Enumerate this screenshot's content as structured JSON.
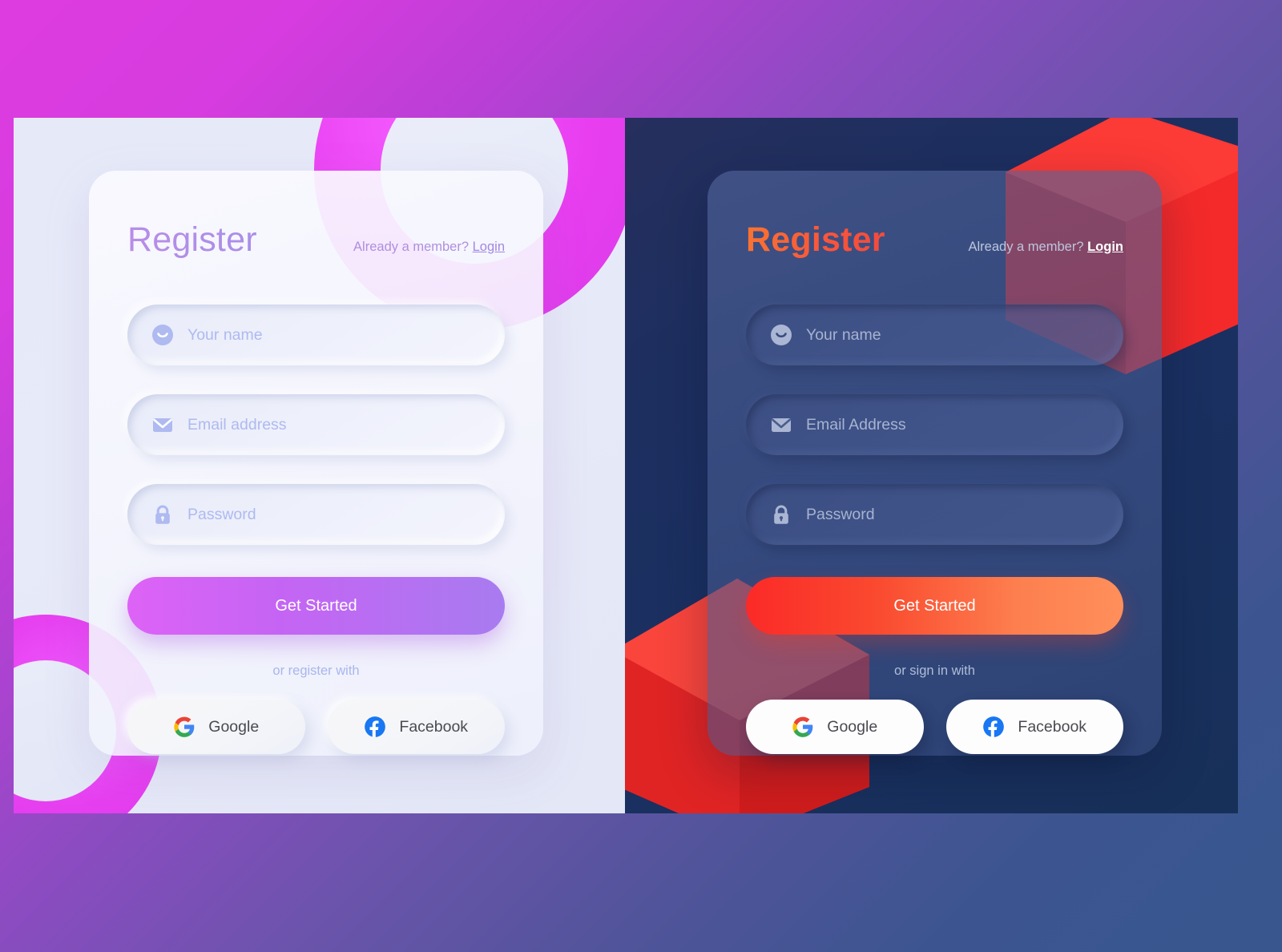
{
  "background": {
    "gradient_from": "#dd3ce0",
    "gradient_mid": "#6a54ab",
    "gradient_to": "#39568f"
  },
  "light_card": {
    "title": "Register",
    "member_prefix": "Already a member?",
    "login_label": "Login",
    "title_color": "#b08ee8",
    "fields": [
      {
        "icon": "smiley-icon",
        "placeholder": "Your name"
      },
      {
        "icon": "envelope-icon",
        "placeholder": "Email address"
      },
      {
        "icon": "lock-icon",
        "placeholder": "Password"
      }
    ],
    "primary_button": "Get Started",
    "primary_gradient_from": "#dd63f6",
    "primary_gradient_to": "#a87bf0",
    "or_text": "or register with",
    "social": [
      {
        "icon": "google-icon",
        "label": "Google"
      },
      {
        "icon": "facebook-icon",
        "label": "Facebook"
      }
    ]
  },
  "dark_card": {
    "title": "Register",
    "member_prefix": "Already a member?",
    "login_label": "Login",
    "title_color": "#f9603a",
    "fields": [
      {
        "icon": "smiley-icon",
        "placeholder": "Your name"
      },
      {
        "icon": "envelope-icon",
        "placeholder": "Email Address"
      },
      {
        "icon": "lock-icon",
        "placeholder": "Password"
      }
    ],
    "primary_button": "Get Started",
    "primary_gradient_from": "#fb2a28",
    "primary_gradient_to": "#ff8f5b",
    "or_text": "or sign in with",
    "social": [
      {
        "icon": "google-icon",
        "label": "Google"
      },
      {
        "icon": "facebook-icon",
        "label": "Facebook"
      }
    ]
  },
  "decorations": {
    "light_panel": "magenta-rings",
    "dark_panel": "red-3d-cubes",
    "light_panel_bg": "#e6eaf8",
    "dark_panel_bg": "#1d2f5f",
    "cube_color": "#f42a2a"
  }
}
